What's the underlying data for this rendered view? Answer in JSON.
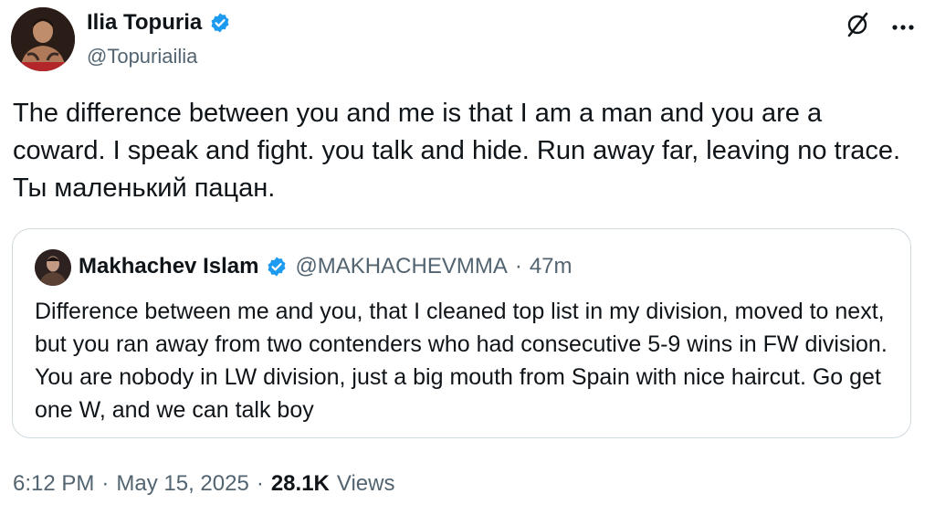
{
  "author": {
    "display_name": "Ilia Topuria",
    "handle": "@Topuriailia",
    "verified": true
  },
  "tweet": {
    "text": "The difference between you and me is that I am a man and you are a coward. I speak and fight. you talk and hide. Run away far, leaving no trace. Ты маленький пацан.",
    "time": "6:12 PM",
    "date": "May 15, 2025",
    "views_count": "28.1K",
    "views_label": "Views",
    "separator": "·"
  },
  "quoted_tweet": {
    "display_name": "Makhachev Islam",
    "handle": "@MAKHACHEVMMA",
    "separator": "·",
    "time": "47m",
    "verified": true,
    "text": "Difference between me and you, that I cleaned top list in my division, moved to next, but you ran away from two contenders who had consecutive 5-9 wins in FW division. You are nobody in LW division, just a big mouth from Spain with nice haircut. Go get one W, and we can talk boy"
  },
  "icons": {
    "verified": "verified-badge-icon",
    "grok": "grok-icon",
    "more": "more-options-icon"
  },
  "colors": {
    "verified_blue": "#1d9bf0",
    "secondary_text": "#536471",
    "border": "#cfd9de"
  }
}
